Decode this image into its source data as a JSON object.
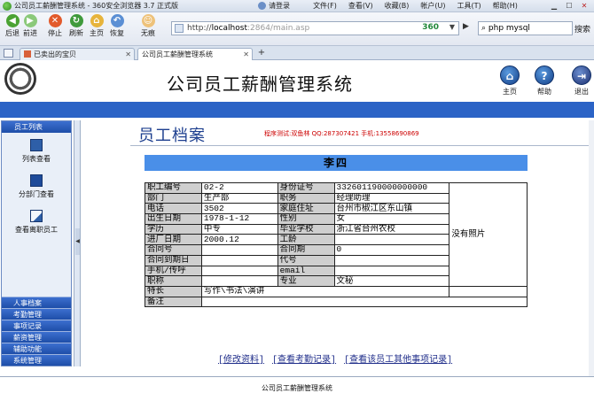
{
  "browser": {
    "window_title": "公司员工薪酬管理系统 - 360安全浏览器 3.7 正式版",
    "login_label": "请登录",
    "menu": [
      "文件(F)",
      "查看(V)",
      "收藏(B)",
      "帐户(U)",
      "工具(T)",
      "帮助(H)"
    ],
    "toolbar": {
      "back": "后退",
      "forward": "前进",
      "stop": "停止",
      "refresh": "刷新",
      "home": "主页",
      "restore": "恢复",
      "noimage": "无痕"
    },
    "address": {
      "scheme": "http://",
      "host": "localhost",
      "path": ":2864/main.asp",
      "brand": "360"
    },
    "search": {
      "value": "php mysql",
      "button": "搜索"
    },
    "tabs": [
      {
        "label": "已卖出的宝贝",
        "active": false
      },
      {
        "label": "公司员工薪酬管理系统",
        "active": true
      }
    ]
  },
  "header": {
    "system_title": "公司员工薪酬管理系统",
    "buttons": {
      "home": "主页",
      "help": "帮助",
      "exit": "退出"
    }
  },
  "leftnav": {
    "section_title": "员工列表",
    "items": [
      {
        "label": "列表查看",
        "icon": "list-icon"
      },
      {
        "label": "分部门查看",
        "icon": "book-icon"
      },
      {
        "label": "查看离职员工",
        "icon": "document-icon"
      }
    ],
    "menu": [
      "人事档案",
      "考勤管理",
      "事项记录",
      "薪资管理",
      "辅助功能",
      "系统管理"
    ]
  },
  "main": {
    "page_title": "员工档案",
    "author_note": "程序测试:双鱼林 QQ:287307421 手机:13558690869",
    "employee_name": "李四",
    "photo_text": "没有照片",
    "rows": [
      {
        "l1": "职工编号",
        "v1": "02-2",
        "l2": "身份证号",
        "v2": "332601190000000000"
      },
      {
        "l1": "部门",
        "v1": "生产部",
        "l2": "职务",
        "v2": "经理助理"
      },
      {
        "l1": "电话",
        "v1": "3502",
        "l2": "家庭住址",
        "v2": "台州市椒江区东山镇"
      },
      {
        "l1": "出生日期",
        "v1": "1978-1-12",
        "l2": "性别",
        "v2": "女"
      },
      {
        "l1": "学历",
        "v1": "中专",
        "l2": "毕业学校",
        "v2": "浙江省台州农校"
      },
      {
        "l1": "进厂日期",
        "v1": "2000.12",
        "l2": "工龄",
        "v2": ""
      },
      {
        "l1": "合同号",
        "v1": "",
        "l2": "合同期",
        "v2": "0"
      },
      {
        "l1": "合同到期日",
        "v1": "",
        "l2": "代号",
        "v2": ""
      },
      {
        "l1": "手机/传呼",
        "v1": "",
        "l2": "email",
        "v2": ""
      },
      {
        "l1": "职称",
        "v1": "",
        "l2": "专业",
        "v2": "文秘"
      }
    ],
    "specialty": {
      "label": "特长",
      "value": "写作\\书法\\演讲"
    },
    "remark": {
      "label": "备注",
      "value": ""
    },
    "links": [
      "[修改资料]",
      "[查看考勤记录]",
      "[查看该员工其他事项记录]"
    ]
  },
  "footer": {
    "text": "公司员工薪酬管理系统"
  }
}
